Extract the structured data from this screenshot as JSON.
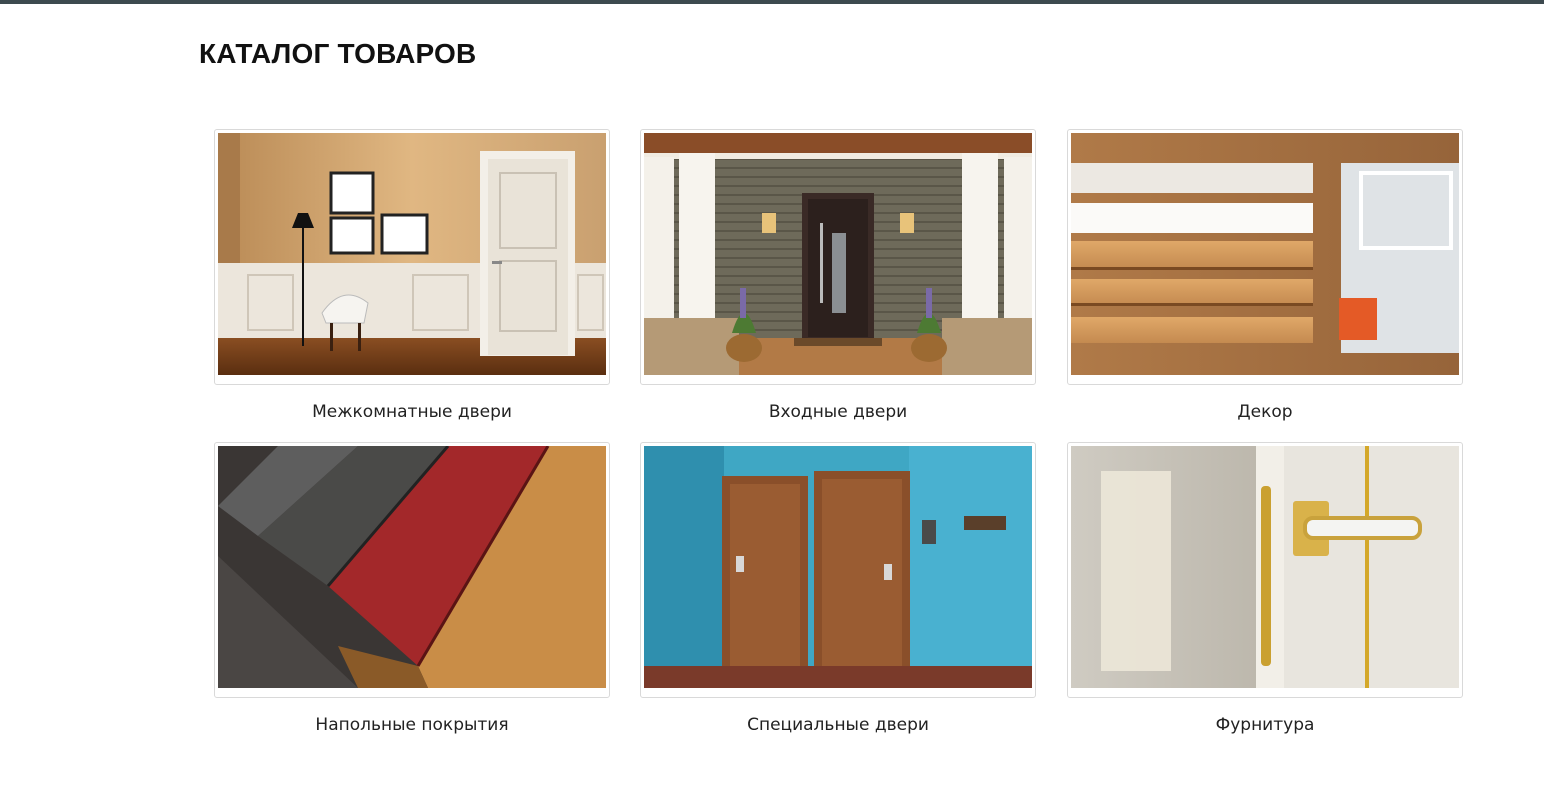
{
  "page": {
    "title": "КАТАЛОГ ТОВАРОВ"
  },
  "catalog": {
    "items": [
      {
        "label": "Межкомнатные двери",
        "image": "interior-door-photo"
      },
      {
        "label": "Входные двери",
        "image": "entrance-door-photo"
      },
      {
        "label": "Декор",
        "image": "decor-moulding-photo"
      },
      {
        "label": "Напольные покрытия",
        "image": "flooring-planks-photo"
      },
      {
        "label": "Специальные двери",
        "image": "special-doors-photo"
      },
      {
        "label": "Фурнитура",
        "image": "door-handle-photo"
      }
    ]
  }
}
